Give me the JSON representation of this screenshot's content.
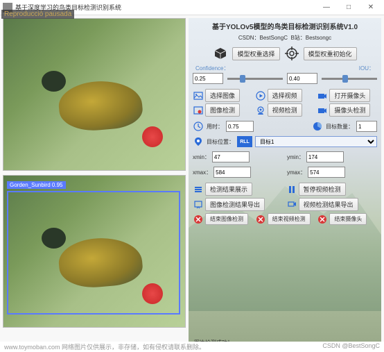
{
  "window": {
    "title": "基于深度学习的鸟类目标检测识别系统",
    "overlay": "Reproducció pausada"
  },
  "header": {
    "title": "基于YOLOv5模型的鸟类目标检测识别系统V1.0",
    "subtitle_left": "CSDN：BestSongC",
    "subtitle_right": "B站：Bestsongc"
  },
  "model_btns": {
    "select": "模型权重选择",
    "init": "模型权重初始化"
  },
  "sliders": {
    "conf_label": "Confidence：",
    "iou_label": "IOU：",
    "conf_value": "0.25",
    "iou_value": "0.40"
  },
  "actions": {
    "sel_img": "选择图像",
    "sel_vid": "选择视频",
    "open_cam": "打开摄像头",
    "det_img": "图像检测",
    "det_vid": "视频检测",
    "det_cam": "摄像头检测"
  },
  "stats": {
    "time_label": "用时：",
    "time_value": "0.75",
    "count_label": "目标数量：",
    "count_value": "1",
    "pos_label": "目标位置：",
    "rll": "RLL",
    "target_sel": "目标1"
  },
  "coords": {
    "xmin_l": "xmin：",
    "xmin_v": "47",
    "ymin_l": "ymin：",
    "ymin_v": "174",
    "xmax_l": "xmax：",
    "xmax_v": "584",
    "ymax_l": "ymax：",
    "ymax_v": "574"
  },
  "footer_btns": {
    "show_res": "检测结果展示",
    "pause_vid": "暂停视频检测",
    "export_img": "图像检测结果导出",
    "export_vid": "视频检测结果导出",
    "end_img": "结束图像检测",
    "end_vid": "结束视频检测",
    "end_cam": "结束摄像头"
  },
  "detection": {
    "label": "Gorden_Sunbird 0.95"
  },
  "status_text": "图片检测成功！",
  "watermark": {
    "left": "www.toymoban.com 网络图片仅供展示，非存储，如有侵权请联系删除。",
    "right": "CSDN @BestSongC"
  }
}
